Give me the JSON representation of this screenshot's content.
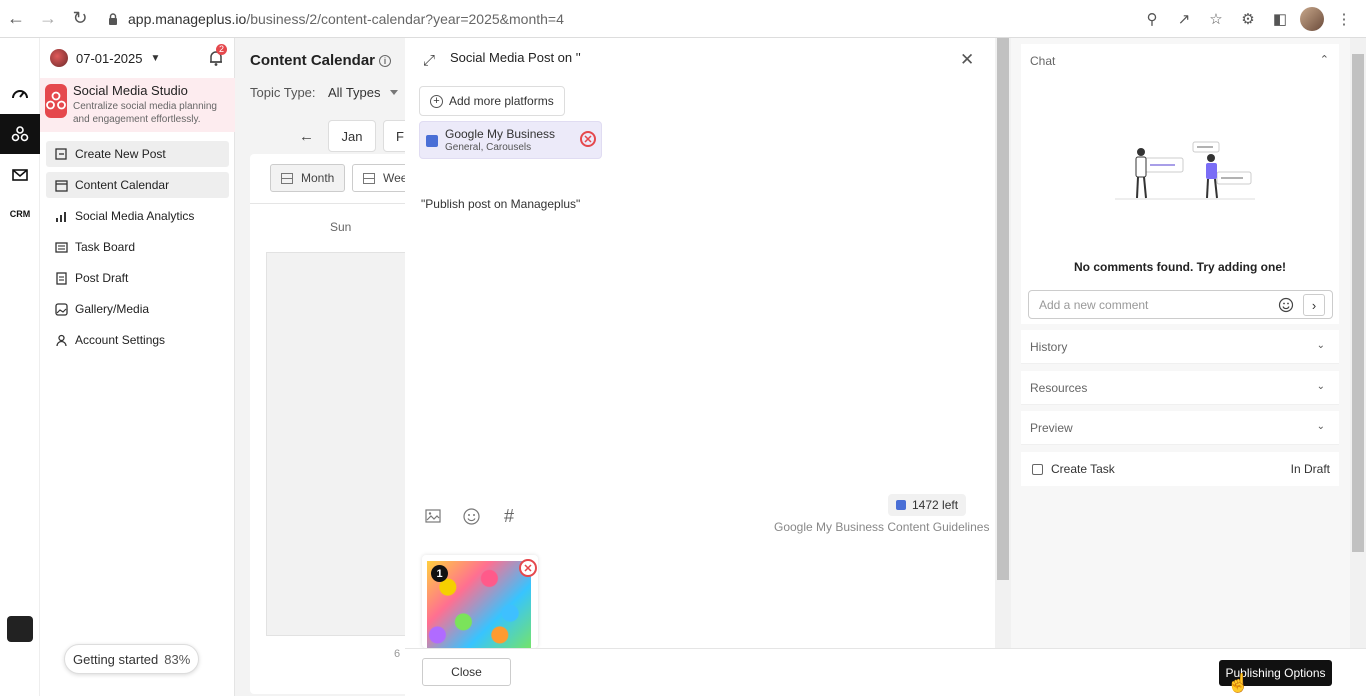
{
  "browser": {
    "url_host": "app.manageplus.io",
    "url_path": "/business/2/content-calendar?year=2025&month=4"
  },
  "sidebar": {
    "date": "07-01-2025",
    "notification_count": "2",
    "studio_title": "Social Media Studio",
    "studio_desc": "Centralize social media planning and engagement effortlessly.",
    "items": [
      {
        "label": "Create New Post",
        "icon": "new-post-icon"
      },
      {
        "label": "Content Calendar",
        "icon": "calendar-icon"
      },
      {
        "label": "Social Media Analytics",
        "icon": "analytics-icon"
      },
      {
        "label": "Task Board",
        "icon": "task-board-icon"
      },
      {
        "label": "Post Draft",
        "icon": "draft-icon"
      },
      {
        "label": "Gallery/Media",
        "icon": "gallery-icon"
      },
      {
        "label": "Account Settings",
        "icon": "user-icon"
      }
    ],
    "getting_started": "Getting started",
    "getting_started_pct": "83%"
  },
  "calendar": {
    "title": "Content Calendar",
    "topic_label": "Topic Type:",
    "topic_value": "All Types",
    "month_jan": "Jan",
    "month_next": "F",
    "view_month": "Month",
    "view_week": "Wee",
    "day_sun": "Sun",
    "cell_number": "6"
  },
  "editor": {
    "title": "Social Media Post on ''",
    "add_platforms": "Add more platforms",
    "platform_name": "Google My Business",
    "platform_sub": "General, Carousels",
    "post_text": "\"Publish post on Manageplus\"",
    "chars_left": "1472 left",
    "guidelines": "Google My Business Content Guidelines",
    "media_index": "1"
  },
  "footer": {
    "close_label": "Close",
    "publish_label": "Publishing Options"
  },
  "right_panel": {
    "chat_title": "Chat",
    "no_comments": "No comments found. Try adding one!",
    "comment_placeholder": "Add a new comment",
    "history": "History",
    "resources": "Resources",
    "preview": "Preview",
    "create_task": "Create Task",
    "task_status": "In Draft"
  },
  "colors": {
    "accent_red": "#e5484d",
    "dark": "#111111",
    "platform_blue": "#4a6fd6"
  }
}
